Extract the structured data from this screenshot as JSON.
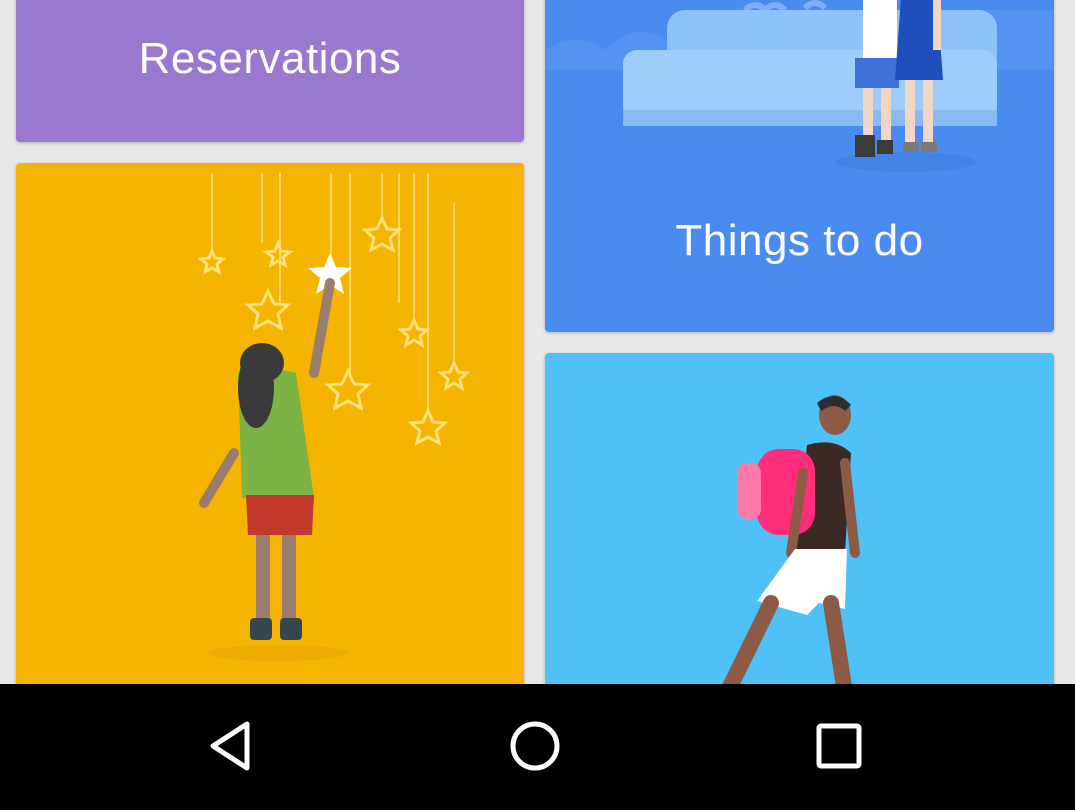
{
  "cards": {
    "reservations": {
      "label": "Reservations",
      "color": "#9a78d0"
    },
    "things_to_do": {
      "label": "Things to do",
      "color": "#4a8bf0"
    },
    "yellow_card": {
      "color": "#f5b400"
    },
    "sky_card": {
      "color": "#4fc1f6"
    }
  },
  "navbar": {
    "buttons": [
      "back-icon",
      "home-icon",
      "recents-icon"
    ],
    "background": "#000000"
  }
}
